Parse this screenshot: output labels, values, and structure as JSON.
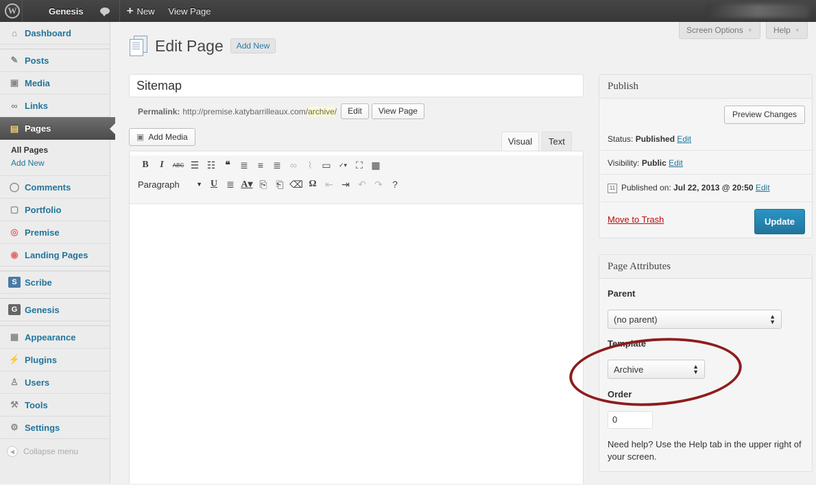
{
  "adminbar": {
    "site_name": "Genesis",
    "new_label": "New",
    "view_page_label": "View Page"
  },
  "sidebar": {
    "items": [
      {
        "label": "Dashboard",
        "icon": "dashboard-icon"
      },
      {
        "label": "Posts",
        "icon": "pin-icon"
      },
      {
        "label": "Media",
        "icon": "media-icon"
      },
      {
        "label": "Links",
        "icon": "link-icon"
      },
      {
        "label": "Pages",
        "icon": "pages-icon"
      },
      {
        "label": "Comments",
        "icon": "comment-icon"
      },
      {
        "label": "Portfolio",
        "icon": "portfolio-icon"
      },
      {
        "label": "Premise",
        "icon": "premise-icon"
      },
      {
        "label": "Landing Pages",
        "icon": "landing-pages-icon"
      },
      {
        "label": "Scribe",
        "icon": "scribe-icon"
      },
      {
        "label": "Genesis",
        "icon": "genesis-icon"
      },
      {
        "label": "Appearance",
        "icon": "appearance-icon"
      },
      {
        "label": "Plugins",
        "icon": "plugin-icon"
      },
      {
        "label": "Users",
        "icon": "users-icon"
      },
      {
        "label": "Tools",
        "icon": "tools-icon"
      },
      {
        "label": "Settings",
        "icon": "settings-icon"
      }
    ],
    "submenu": [
      "All Pages",
      "Add New"
    ],
    "collapse_label": "Collapse menu"
  },
  "screen_meta": {
    "screen_options": "Screen Options",
    "help": "Help"
  },
  "heading": {
    "title": "Edit Page",
    "add_new": "Add New"
  },
  "post": {
    "title": "Sitemap",
    "permalink_label": "Permalink:",
    "permalink_base": "http://premise.katybarrilleaux.com/",
    "permalink_slug": "archive",
    "permalink_trailing": "/",
    "edit_button": "Edit",
    "view_page_button": "View Page"
  },
  "editor": {
    "add_media": "Add Media",
    "tab_visual": "Visual",
    "tab_text": "Text",
    "format": "Paragraph",
    "content": ""
  },
  "publish": {
    "heading": "Publish",
    "preview_button": "Preview Changes",
    "status_label": "Status:",
    "status_value": "Published",
    "visibility_label": "Visibility:",
    "visibility_value": "Public",
    "edit_link": "Edit",
    "published_on_label": "Published on:",
    "published_on_value": "Jul 22, 2013 @ 20:50",
    "trash_link": "Move to Trash",
    "update_button": "Update"
  },
  "attributes": {
    "heading": "Page Attributes",
    "parent_label": "Parent",
    "parent_value": "(no parent)",
    "template_label": "Template",
    "template_value": "Archive",
    "order_label": "Order",
    "order_value": "0",
    "help_text": "Need help? Use the Help tab in the upper right of your screen."
  },
  "colors": {
    "link": "#21759b",
    "primary_button": "#21759b",
    "trash": "#bc0b0b",
    "annotation": "#8e1d1d"
  }
}
